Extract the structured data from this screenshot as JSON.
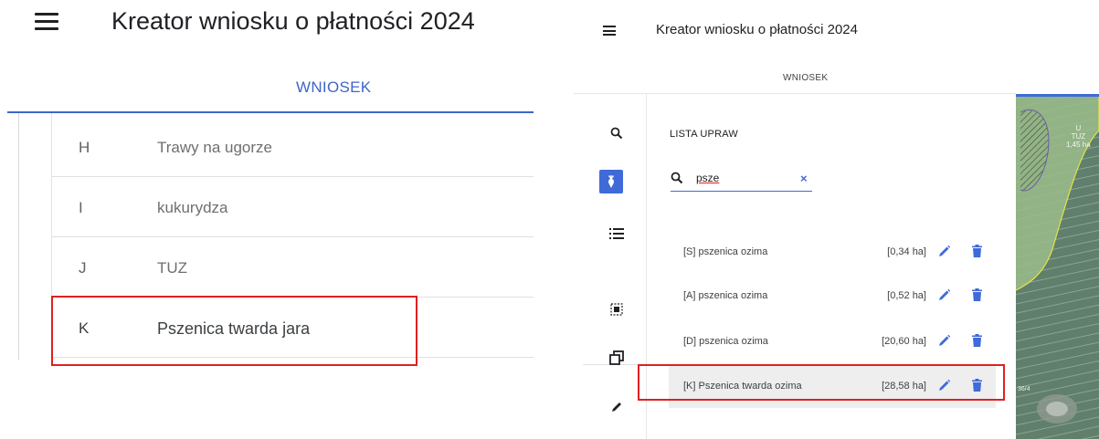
{
  "left": {
    "title": "Kreator wniosku o płatności 2024",
    "tab": "WNIOSEK",
    "rows": [
      {
        "code": "H",
        "name": "Trawy na ugorze"
      },
      {
        "code": "I",
        "name": "kukurydza"
      },
      {
        "code": "J",
        "name": "TUZ"
      },
      {
        "code": "K",
        "name": "Pszenica twarda jara"
      }
    ]
  },
  "right": {
    "title": "Kreator wniosku o płatności 2024",
    "tab": "WNIOSEK",
    "list_heading": "LISTA UPRAW",
    "search": {
      "value": "psze",
      "clear": "×"
    },
    "items": [
      {
        "name": "[S] pszenica ozima",
        "area": "[0,34 ha]"
      },
      {
        "name": "[A] pszenica ozima",
        "area": "[0,52 ha]"
      },
      {
        "name": "[D] pszenica ozima",
        "area": "[20,60 ha]"
      },
      {
        "name": "[K] Pszenica twarda ozima",
        "area": "[28,58 ha]"
      }
    ],
    "map": {
      "label_parcel": "U",
      "label_code": "TUZ",
      "label_area": "1,45 ha",
      "label_bottom": "36/4"
    }
  },
  "colors": {
    "accent": "#3f6ad8",
    "highlight": "#e02020",
    "text": "#202124"
  }
}
